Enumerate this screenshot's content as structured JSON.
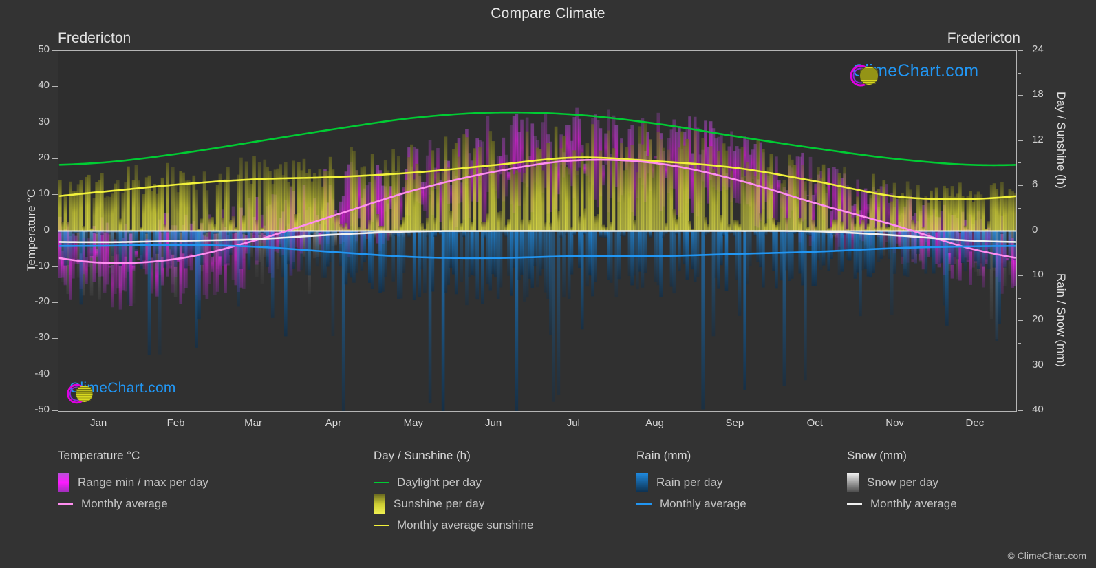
{
  "header": {
    "title": "Compare Climate",
    "city_left": "Fredericton",
    "city_right": "Fredericton"
  },
  "watermark": {
    "logo_text": "ClimeChart.com",
    "copyright": "© ClimeChart.com"
  },
  "axes": {
    "left_title": "Temperature °C",
    "right_title_top": "Day / Sunshine (h)",
    "right_title_bottom": "Rain / Snow (mm)",
    "left_ticks": [
      "50",
      "40",
      "30",
      "20",
      "10",
      "0",
      "-10",
      "-20",
      "-30",
      "-40",
      "-50"
    ],
    "right_ticks_top": [
      "24",
      "18",
      "12",
      "6",
      "0"
    ],
    "right_ticks_bottom": [
      "0",
      "10",
      "20",
      "30",
      "40"
    ],
    "x_ticks": [
      "Jan",
      "Feb",
      "Mar",
      "Apr",
      "May",
      "Jun",
      "Jul",
      "Aug",
      "Sep",
      "Oct",
      "Nov",
      "Dec"
    ]
  },
  "legend": {
    "temperature": {
      "heading": "Temperature °C",
      "items": [
        {
          "label": "Range min / max per day",
          "marker": "gradient-box",
          "color": "#ff00ff"
        },
        {
          "label": "Monthly average",
          "marker": "line",
          "color": "#ff8ef0"
        }
      ]
    },
    "sunshine": {
      "heading": "Day / Sunshine (h)",
      "items": [
        {
          "label": "Daylight per day",
          "marker": "line",
          "color": "#00cc33"
        },
        {
          "label": "Sunshine per day",
          "marker": "gradient-box",
          "color": "#f2f24d"
        },
        {
          "label": "Monthly average sunshine",
          "marker": "line",
          "color": "#f2f23b"
        }
      ]
    },
    "rain": {
      "heading": "Rain (mm)",
      "items": [
        {
          "label": "Rain per day",
          "marker": "gradient-box",
          "color": "#0d8bf2"
        },
        {
          "label": "Monthly average",
          "marker": "line",
          "color": "#2196f3"
        }
      ]
    },
    "snow": {
      "heading": "Snow (mm)",
      "items": [
        {
          "label": "Snow per day",
          "marker": "gradient-box",
          "color": "#e8e8e8"
        },
        {
          "label": "Monthly average",
          "marker": "line",
          "color": "#f0f0f0"
        }
      ]
    }
  },
  "chart_data": {
    "type": "area",
    "title": "Compare Climate",
    "subtitle": "Fredericton",
    "location": "Fredericton",
    "xlabel": "",
    "ylabel": "Temperature °C",
    "y2label_top": "Day / Sunshine (h)",
    "y2label_bottom": "Rain / Snow (mm)",
    "ylim": [
      -50,
      50
    ],
    "y2lim_top": [
      0,
      24
    ],
    "y2lim_bottom": [
      0,
      40
    ],
    "grid": true,
    "legend_position": "below",
    "categories": [
      "Jan",
      "Feb",
      "Mar",
      "Apr",
      "May",
      "Jun",
      "Jul",
      "Aug",
      "Sep",
      "Oct",
      "Nov",
      "Dec"
    ],
    "series": [
      {
        "name": "Monthly average temperature",
        "unit": "°C",
        "color": "#ff8ef0",
        "values": [
          -8.8,
          -7.7,
          -2.6,
          4.4,
          11.4,
          16.5,
          19.6,
          18.8,
          14.2,
          7.6,
          1.4,
          -5.3
        ]
      },
      {
        "name": "Daily max temperature (range top)",
        "unit": "°C",
        "color": "#ff00ff",
        "values": [
          -3.0,
          -1.8,
          3.3,
          10.8,
          18.5,
          23.6,
          26.4,
          25.5,
          20.7,
          13.5,
          6.2,
          -0.5
        ]
      },
      {
        "name": "Daily min temperature (range bottom)",
        "unit": "°C",
        "color": "#c000d0",
        "values": [
          -14.6,
          -13.6,
          -8.4,
          -1.2,
          4.3,
          9.4,
          12.7,
          12.0,
          7.6,
          1.8,
          -3.3,
          -10.2
        ]
      },
      {
        "name": "Daylight per day",
        "unit": "h",
        "color": "#00cc33",
        "values": [
          9.1,
          10.3,
          11.9,
          13.6,
          15.1,
          15.8,
          15.5,
          14.3,
          12.6,
          11.0,
          9.6,
          8.8
        ]
      },
      {
        "name": "Monthly average sunshine",
        "unit": "h",
        "color": "#f2f23b",
        "values": [
          5.2,
          6.2,
          6.9,
          7.2,
          7.8,
          8.8,
          9.8,
          9.3,
          8.4,
          6.6,
          4.6,
          4.3
        ]
      },
      {
        "name": "Monthly average rain",
        "unit": "mm",
        "color": "#2196f3",
        "values": [
          3.3,
          3.1,
          3.5,
          4.7,
          5.8,
          6.0,
          5.6,
          5.6,
          5.1,
          4.6,
          3.8,
          3.4
        ]
      },
      {
        "name": "Monthly average snow",
        "unit": "mm",
        "color": "#f0f0f0",
        "values": [
          2.5,
          2.2,
          1.8,
          0.8,
          0.1,
          0.0,
          0.0,
          0.0,
          0.0,
          0.1,
          1.0,
          2.2
        ]
      }
    ],
    "annotations": [
      {
        "text": "Fredericton",
        "position": "top-left"
      },
      {
        "text": "Fredericton",
        "position": "top-right"
      }
    ]
  }
}
